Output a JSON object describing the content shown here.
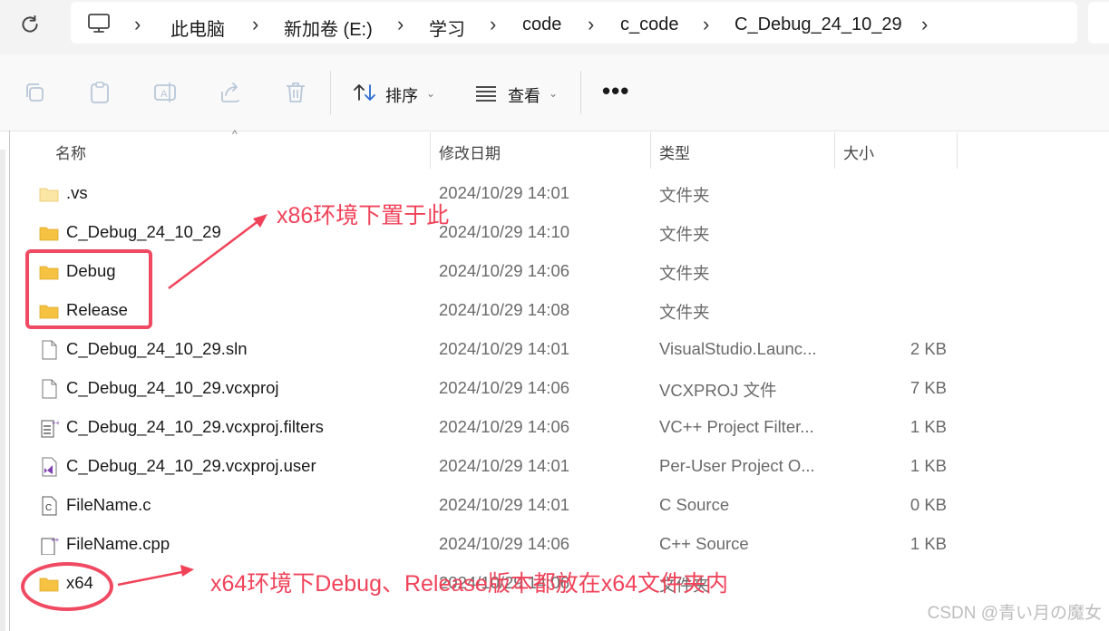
{
  "address_bar": {
    "crumbs": [
      "此电脑",
      "新加卷 (E:)",
      "学习",
      "code",
      "c_code",
      "C_Debug_24_10_29"
    ]
  },
  "toolbar": {
    "sort_label": "排序",
    "view_label": "查看",
    "more_label": "•••"
  },
  "columns": {
    "name": "名称",
    "date": "修改日期",
    "type": "类型",
    "size": "大小"
  },
  "files": [
    {
      "name": ".vs",
      "date": "2024/10/29 14:01",
      "type": "文件夹",
      "size": "",
      "icon": "folder-icon"
    },
    {
      "name": "C_Debug_24_10_29",
      "date": "2024/10/29 14:10",
      "type": "文件夹",
      "size": "",
      "icon": "folder-icon"
    },
    {
      "name": "Debug",
      "date": "2024/10/29 14:06",
      "type": "文件夹",
      "size": "",
      "icon": "folder-icon"
    },
    {
      "name": "Release",
      "date": "2024/10/29 14:08",
      "type": "文件夹",
      "size": "",
      "icon": "folder-icon"
    },
    {
      "name": "C_Debug_24_10_29.sln",
      "date": "2024/10/29 14:01",
      "type": "VisualStudio.Launc...",
      "size": "2 KB",
      "icon": "document-icon"
    },
    {
      "name": "C_Debug_24_10_29.vcxproj",
      "date": "2024/10/29 14:06",
      "type": "VCXPROJ 文件",
      "size": "7 KB",
      "icon": "document-icon"
    },
    {
      "name": "C_Debug_24_10_29.vcxproj.filters",
      "date": "2024/10/29 14:06",
      "type": "VC++ Project Filter...",
      "size": "1 KB",
      "icon": "filters-file-icon"
    },
    {
      "name": "C_Debug_24_10_29.vcxproj.user",
      "date": "2024/10/29 14:01",
      "type": "Per-User Project O...",
      "size": "1 KB",
      "icon": "visual-studio-file-icon"
    },
    {
      "name": "FileName.c",
      "date": "2024/10/29 14:01",
      "type": "C Source",
      "size": "0 KB",
      "icon": "c-source-icon"
    },
    {
      "name": "FileName.cpp",
      "date": "2024/10/29 14:06",
      "type": "C++ Source",
      "size": "1 KB",
      "icon": "cpp-source-icon"
    },
    {
      "name": "x64",
      "date": "2024/10/29 14:06",
      "type": "文件夹",
      "size": "",
      "icon": "folder-icon"
    }
  ],
  "annotations": {
    "x86_note": "x86环境下置于此",
    "x64_note": "x64环境下Debug、Release版本都放在x64文件夹内"
  },
  "watermark": "CSDN @青い月の魔女",
  "colors": {
    "annotation": "#f0435a",
    "folder": "#f5c242",
    "background": "#ffffff"
  }
}
